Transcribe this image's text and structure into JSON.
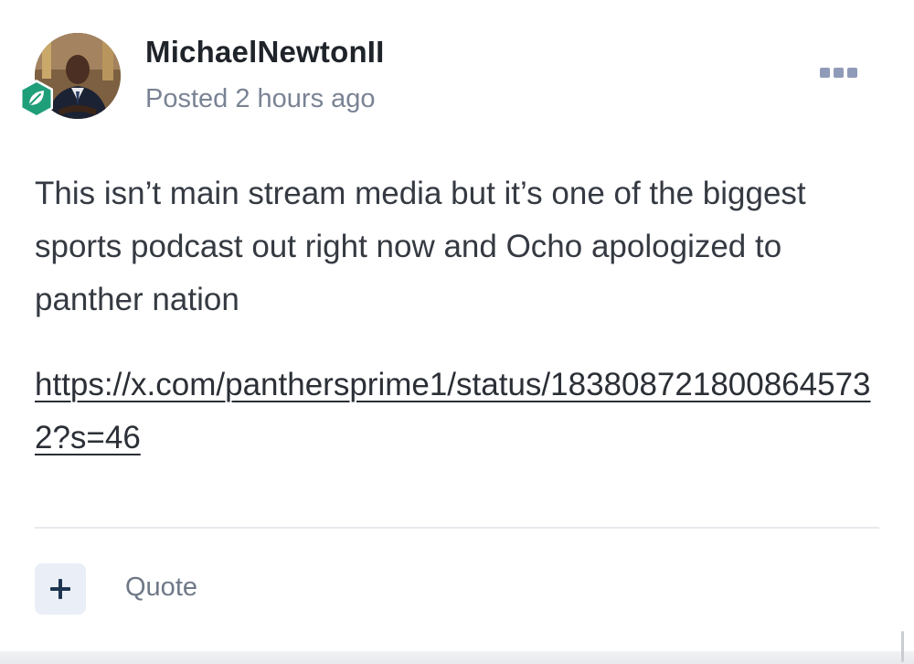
{
  "post": {
    "author": "MichaelNewtonII",
    "posted": "Posted 2 hours ago",
    "body": "This isn’t main stream media but it’s one of the biggest sports podcast out right now and Ocho apologized to panther nation",
    "link": "https://x.com/panthersprime1/status/1838087218008645732?s=46"
  },
  "actions": {
    "quote_label": "Quote"
  },
  "icons": {
    "more": "more-horizontal-icon",
    "add": "plus-icon",
    "badge": "leaf-badge-icon"
  },
  "colors": {
    "badge": "#1f9e7a",
    "more_icon": "#8f9bb8",
    "add_button_bg": "#e9eef7",
    "add_button_fg": "#1e3552"
  }
}
